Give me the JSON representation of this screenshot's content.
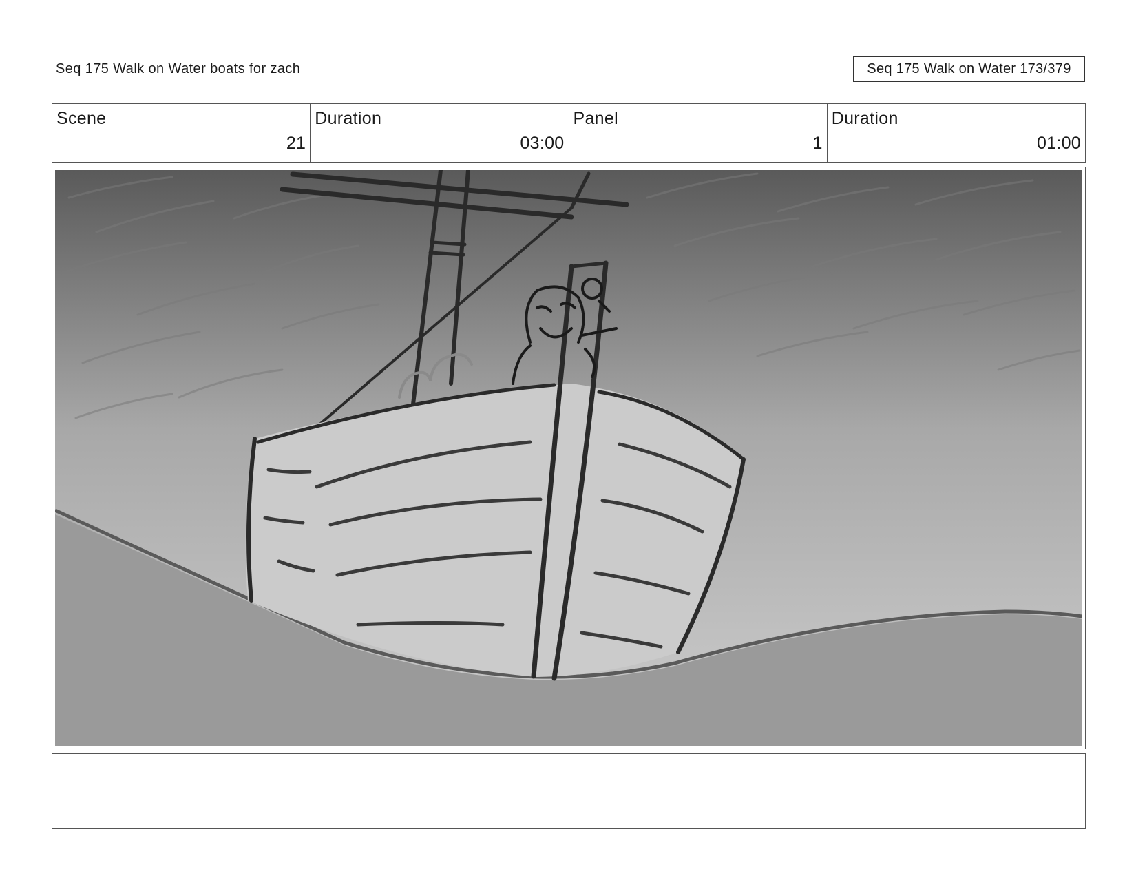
{
  "header": {
    "title": "Seq 175 Walk on Water  boats for zach",
    "page_indicator": "Seq 175 Walk on Water 173/379"
  },
  "info": {
    "scene_label": "Scene",
    "scene_value": "21",
    "scene_duration_label": "Duration",
    "scene_duration_value": "03:00",
    "panel_label": "Panel",
    "panel_value": "1",
    "panel_duration_label": "Duration",
    "panel_duration_value": "01:00"
  },
  "panel": {
    "icon": "storyboard-sketch-boat-on-wave",
    "colors": {
      "sky_top": "#5a5a5a",
      "sky_bottom": "#cdcdcd",
      "sea": "#999999",
      "line": "#2a2a2a"
    }
  },
  "notes": {
    "text": ""
  }
}
